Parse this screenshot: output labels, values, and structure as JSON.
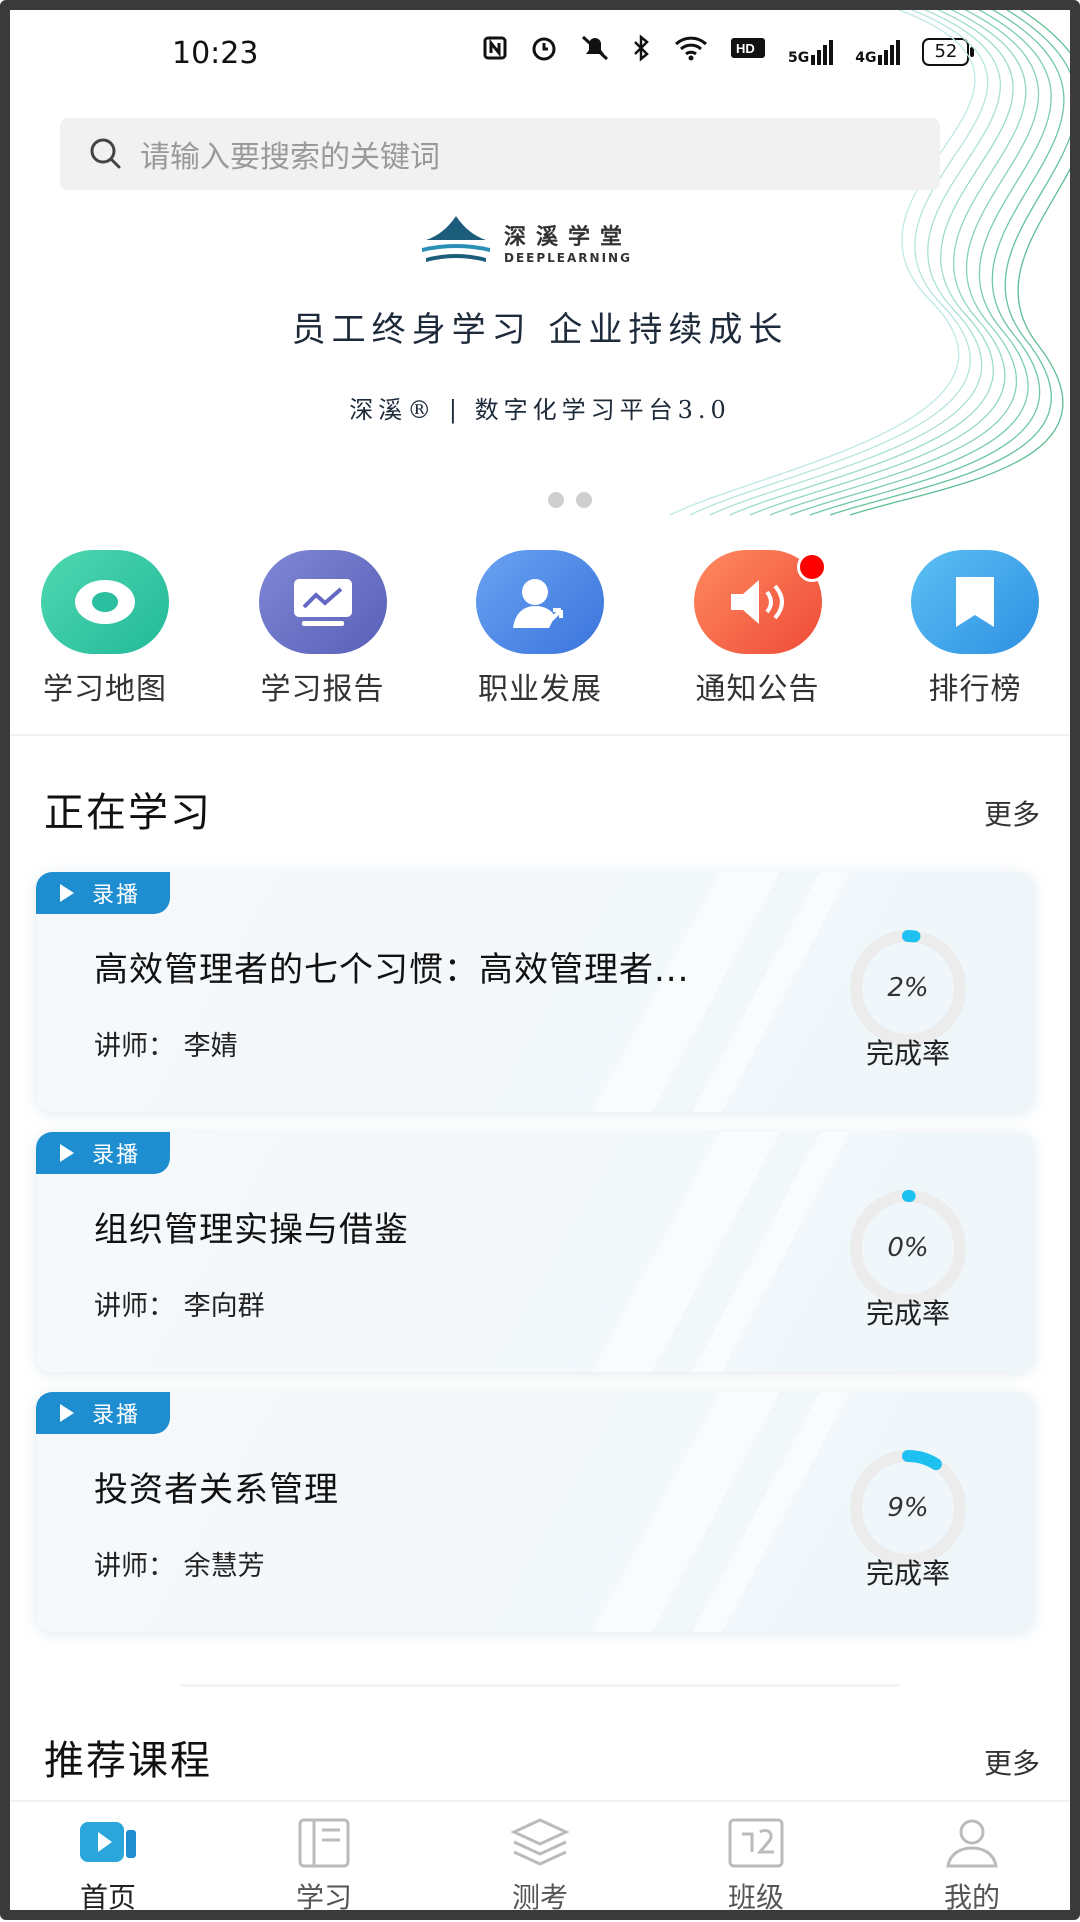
{
  "status_bar": {
    "time": "10:23",
    "sig1": "5G",
    "sig2": "4G",
    "battery": "52"
  },
  "search": {
    "placeholder": "请输入要搜索的关键词"
  },
  "banner": {
    "logo_cn": "深溪学堂",
    "logo_en": "DEEPLEARNING",
    "slogan": "员工终身学习  企业持续成长",
    "platform": "深溪® | 数字化学习平台3.0",
    "page_count": 2
  },
  "quick_menu": [
    {
      "label": "学习地图",
      "icon": "map-icon",
      "color": "#32c9a4"
    },
    {
      "label": "学习报告",
      "icon": "report-icon",
      "color": "#6f74c9"
    },
    {
      "label": "职业发展",
      "icon": "career-icon",
      "color": "#4a86e8"
    },
    {
      "label": "通知公告",
      "icon": "speaker-icon",
      "color": "#f6634a",
      "has_badge": true
    },
    {
      "label": "排行榜",
      "icon": "bookmark-icon",
      "color": "#3fa4ea"
    }
  ],
  "learning": {
    "title": "正在学习",
    "more": "更多",
    "rate_label": "完成率",
    "courses": [
      {
        "tag": "录播",
        "title": "高效管理者的七个习惯：高效管理者...",
        "lecturer": "讲师：  李婧",
        "percent": "2%",
        "progress": 0.02
      },
      {
        "tag": "录播",
        "title": "组织管理实操与借鉴",
        "lecturer": "讲师：  李向群",
        "percent": "0%",
        "progress": 0.0
      },
      {
        "tag": "录播",
        "title": "投资者关系管理",
        "lecturer": "讲师：  余慧芳",
        "percent": "9%",
        "progress": 0.09
      }
    ]
  },
  "recommend": {
    "title": "推荐课程",
    "more": "更多"
  },
  "tabs": [
    {
      "label": "首页",
      "icon": "home-video-icon",
      "active": true
    },
    {
      "label": "学习",
      "icon": "notebook-icon",
      "active": false
    },
    {
      "label": "测考",
      "icon": "layers-icon",
      "active": false
    },
    {
      "label": "班级",
      "icon": "class-icon",
      "active": false
    },
    {
      "label": "我的",
      "icon": "user-icon",
      "active": false
    }
  ],
  "colors": {
    "accent": "#1f8ed0",
    "progress": "#1ec0f0",
    "ring_track": "#ececec"
  }
}
